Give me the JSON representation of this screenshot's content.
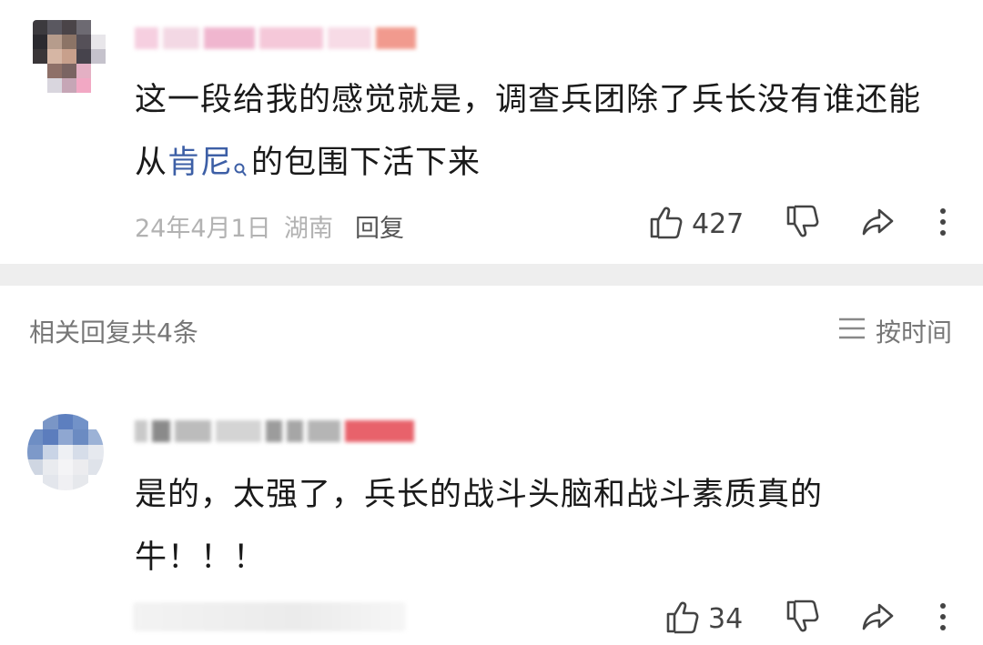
{
  "comment": {
    "text_line1": "这一段给我的感觉就是，调查兵团除了兵长没有谁还能",
    "text_line2_prefix": "从",
    "text_link": "肯尼",
    "text_line2_suffix": "的包围下活下来",
    "date": "24年4月1日",
    "location": "湖南",
    "reply_label": "回复",
    "like_count": "427"
  },
  "replies_header": {
    "title": "相关回复共4条",
    "sort_label": "按时间"
  },
  "reply": {
    "text_line1": "是的，太强了，兵长的战斗头脑和战斗素质真的",
    "text_line2": "牛！！！",
    "like_count": "34"
  },
  "icons": {
    "like": "thumbs-up-icon",
    "dislike": "thumbs-down-icon",
    "share": "share-icon",
    "more": "more-vertical-icon",
    "search": "search-icon",
    "sort": "sort-lines-icon"
  },
  "colors": {
    "link": "#3d5fa6",
    "meta": "#b2b2b2",
    "divider": "#eeeeee"
  }
}
